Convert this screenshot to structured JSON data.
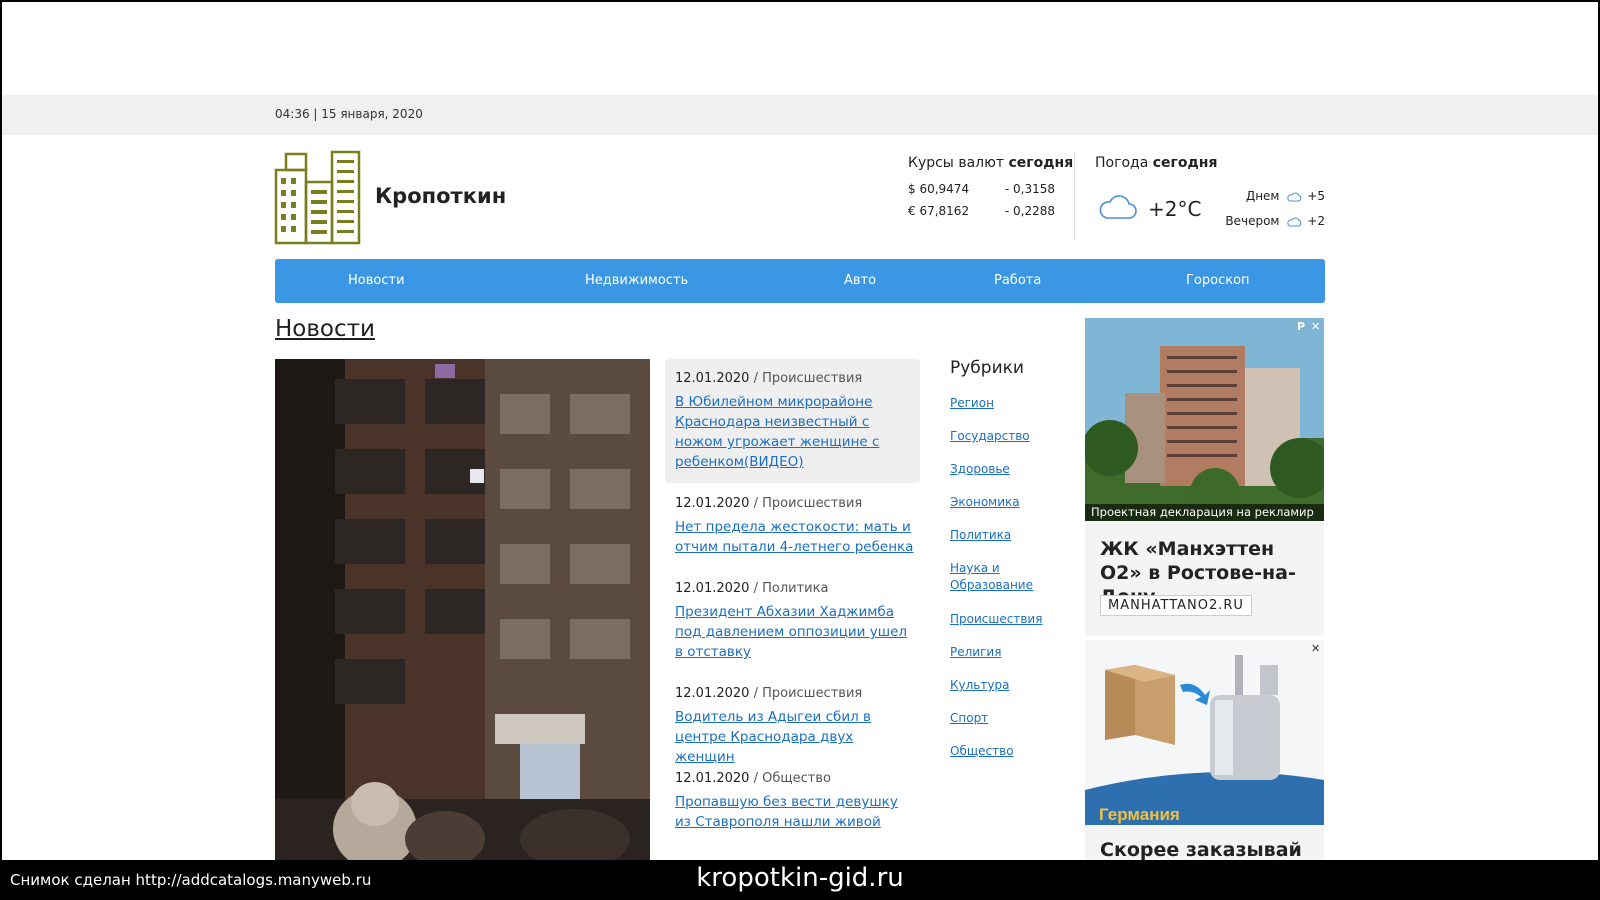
{
  "topbar": {
    "datetime": "04:36 | 15 января, 2020"
  },
  "header": {
    "site_title": "Кропоткин",
    "currency": {
      "title_prefix": "Курсы валют",
      "title_bold": "сегодня",
      "rates": [
        {
          "rate": "$ 60,9474",
          "change": "- 0,3158"
        },
        {
          "rate": "€ 67,8162",
          "change": "- 0,2288"
        }
      ]
    },
    "weather": {
      "title_prefix": "Погода",
      "title_bold": "сегодня",
      "current_temp": "+2°C",
      "day_label": "Днем",
      "day_temp": "+5",
      "evening_label": "Вечером",
      "evening_temp": "+2",
      "icon": "cloud-icon"
    }
  },
  "nav": {
    "items": [
      "Новости",
      "Недвижимость",
      "Авто",
      "Работа",
      "Гороскоп"
    ]
  },
  "main": {
    "section_title": "Новости",
    "news": [
      {
        "date": "12.01.2020",
        "category": "/ Происшествия",
        "title": "В Юбилейном микрорайоне Краснодара неизвестный с ножом угрожает женщине с ребенком(ВИДЕО)"
      },
      {
        "date": "12.01.2020",
        "category": "/ Происшествия",
        "title": "Нет предела жестокости: мать и отчим пытали 4-летнего ребенка"
      },
      {
        "date": "12.01.2020",
        "category": "/ Политика",
        "title": "Президент Абхазии Хаджимба под давлением оппозиции ушел в отставку"
      },
      {
        "date": "12.01.2020",
        "category": "/ Происшествия",
        "title": "Водитель из Адыгеи сбил в центре Краснодара двух женщин"
      },
      {
        "date": "12.01.2020",
        "category": "/ Общество",
        "title": "Пропавшую без вести девушку из Ставрополя нашли живой"
      }
    ],
    "rubrics": {
      "title": "Рубрики",
      "items": [
        "Регион",
        "Государство",
        "Здоровье",
        "Экономика",
        "Политика",
        "Наука и Образование",
        "Происшествия",
        "Религия",
        "Культура",
        "Спорт",
        "Общество"
      ]
    }
  },
  "ads": {
    "ad1": {
      "caption": "Проектная декларация на рекламир",
      "headline": "ЖК «Манхэттен О2» в Ростове-на-Дону",
      "button": "MANHATTANO2.RU",
      "badge": "Р",
      "close": "✕"
    },
    "ad2": {
      "image_text": "Германия",
      "headline": "Скорее заказывай",
      "close": "✕"
    }
  },
  "footer": {
    "snapshot": "Снимок сделан http://addcatalogs.manyweb.ru",
    "domain": "kropotkin-gid.ru"
  }
}
